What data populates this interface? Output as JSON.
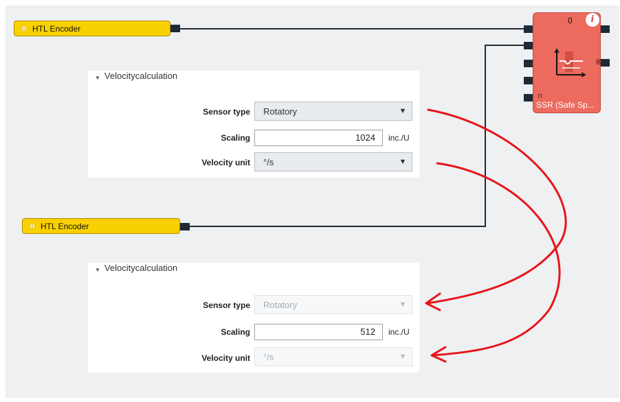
{
  "encoder1": {
    "label": "HTL Encoder",
    "icon": "encoder-icon"
  },
  "encoder2": {
    "label": "HTL Encoder",
    "icon": "encoder-icon"
  },
  "panel1": {
    "title": "Velocitycalculation",
    "sensor_type": {
      "label": "Sensor type",
      "value": "Rotatory"
    },
    "scaling": {
      "label": "Scaling",
      "value": "1024",
      "unit": "inc./U"
    },
    "velocity_unit": {
      "label": "Velocity unit",
      "value": "°/s"
    }
  },
  "panel2": {
    "title": "Velocitycalculation",
    "sensor_type": {
      "label": "Sensor type",
      "value": "Rotatory"
    },
    "scaling": {
      "label": "Scaling",
      "value": "512",
      "unit": "inc./U"
    },
    "velocity_unit": {
      "label": "Velocity unit",
      "value": "°/s"
    }
  },
  "ssr": {
    "name": "SSR (Safe Sp...",
    "count": "0",
    "info": "i"
  },
  "colors": {
    "annotation_arrow": "#e8141b",
    "encoder": "#f9d000",
    "ssr": "#ec6a5e"
  }
}
